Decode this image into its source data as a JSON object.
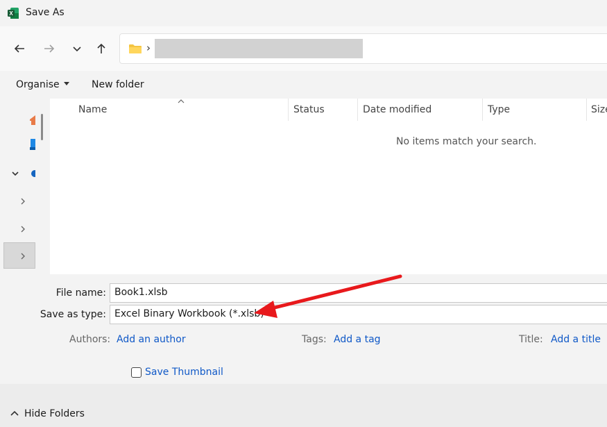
{
  "window": {
    "title": "Save As"
  },
  "icons": {
    "app": "excel-icon",
    "back": "back-arrow-icon",
    "forward": "forward-arrow-icon",
    "recent": "chevron-down-icon",
    "up": "up-arrow-icon",
    "folder": "folder-icon",
    "sort": "sort-up-icon"
  },
  "toolbar": {
    "organise_label": "Organise",
    "new_folder_label": "New folder"
  },
  "list": {
    "columns": [
      "Name",
      "Status",
      "Date modified",
      "Type",
      "Size"
    ],
    "empty_message": "No items match your search."
  },
  "form": {
    "file_name_label": "File name:",
    "file_name_value": "Book1.xlsb",
    "save_type_label": "Save as type:",
    "save_type_value": "Excel Binary Workbook (*.xlsb)",
    "authors_label": "Authors:",
    "authors_link": "Add an author",
    "tags_label": "Tags:",
    "tags_link": "Add a tag",
    "title_label": "Title:",
    "title_link": "Add a title",
    "thumbnail_label": "Save Thumbnail"
  },
  "footer": {
    "hide_folders_label": "Hide Folders"
  },
  "colors": {
    "accent_link": "#0f58c7",
    "annotation_arrow": "#e8191c",
    "excel_green": "#1d7044"
  }
}
